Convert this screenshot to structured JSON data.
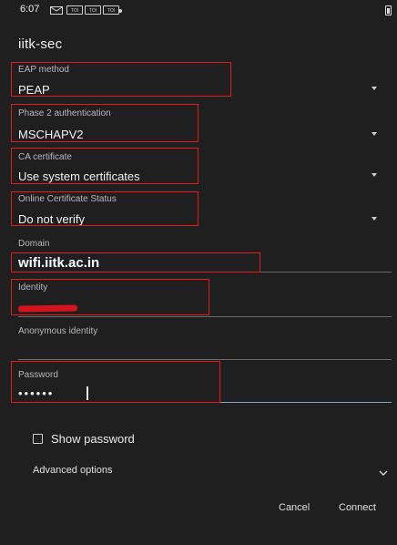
{
  "status_bar": {
    "time": "6:07",
    "notif_labels": [
      "TOI",
      "TOI",
      "TOI"
    ]
  },
  "dialog": {
    "title": "iitk-sec"
  },
  "fields": {
    "eap_method": {
      "label": "EAP method",
      "value": "PEAP"
    },
    "phase2": {
      "label": "Phase 2 authentication",
      "value": "MSCHAPV2"
    },
    "ca_cert": {
      "label": "CA certificate",
      "value": "Use system certificates"
    },
    "ocsp": {
      "label": "Online Certificate Status",
      "value": "Do not verify"
    },
    "domain": {
      "label": "Domain",
      "value": "wifi.iitk.ac.in"
    },
    "identity": {
      "label": "Identity"
    },
    "anonymous": {
      "label": "Anonymous identity",
      "value": ""
    },
    "password": {
      "label": "Password",
      "value": "••••••"
    }
  },
  "show_password": {
    "label": "Show password",
    "checked": false
  },
  "advanced": {
    "label": "Advanced options"
  },
  "buttons": {
    "cancel": "Cancel",
    "connect": "Connect"
  },
  "colors": {
    "background": "#1f1f1f",
    "annotation": "#e21a1a",
    "redaction": "#d4141c",
    "focus": "#8aa0c8"
  }
}
